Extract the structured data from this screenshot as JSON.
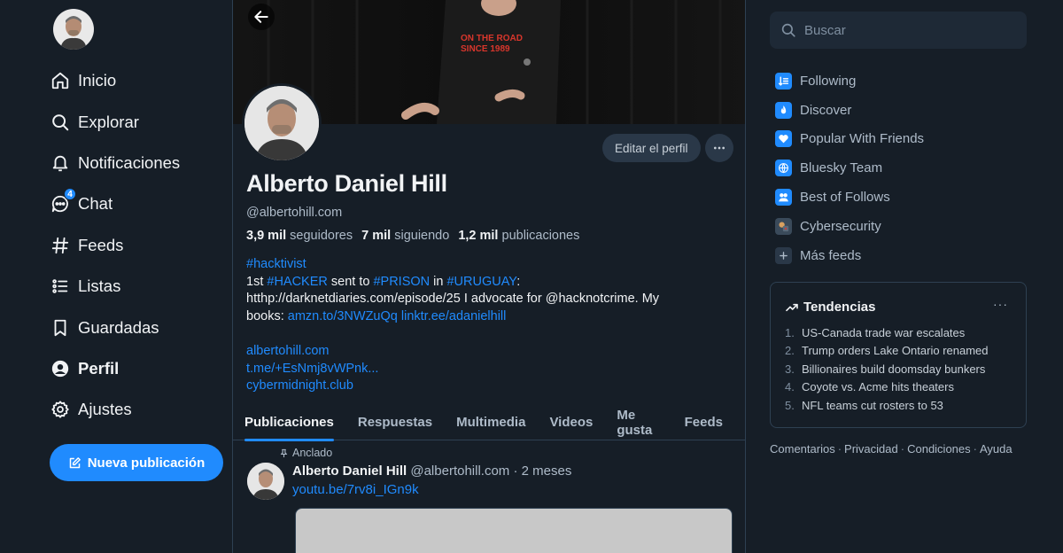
{
  "nav": {
    "items": [
      {
        "id": "home",
        "label": "Inicio",
        "icon": "home-icon"
      },
      {
        "id": "explore",
        "label": "Explorar",
        "icon": "search-icon"
      },
      {
        "id": "notifications",
        "label": "Notificaciones",
        "icon": "bell-icon"
      },
      {
        "id": "chat",
        "label": "Chat",
        "icon": "chat-bubble-icon",
        "badge": "4"
      },
      {
        "id": "feeds",
        "label": "Feeds",
        "icon": "hash-icon"
      },
      {
        "id": "lists",
        "label": "Listas",
        "icon": "list-icon"
      },
      {
        "id": "saved",
        "label": "Guardadas",
        "icon": "bookmark-icon"
      },
      {
        "id": "profile",
        "label": "Perfil",
        "icon": "user-circle-icon",
        "active": true
      },
      {
        "id": "settings",
        "label": "Ajustes",
        "icon": "gear-icon"
      }
    ],
    "new_post_label": "Nueva publicación"
  },
  "profile": {
    "display_name": "Alberto Daniel Hill",
    "handle": "@albertohill.com",
    "edit_label": "Editar el perfil",
    "stats": {
      "followers_count": "3,9 mil",
      "followers_label": "seguidores",
      "following_count": "7 mil",
      "following_label": "siguiendo",
      "posts_count": "1,2 mil",
      "posts_label": "publicaciones"
    },
    "bio": {
      "line1_tag": "#hacktivist",
      "line2_prefix": "1st ",
      "line2_tag1": "#HACKER",
      "line2_mid1": " sent to ",
      "line2_tag2": "#PRISON",
      "line2_mid2": " in ",
      "line2_tag3": "#URUGUAY",
      "line2_suffix": ":",
      "line3": "htthp://darknetdiaries.com/episode/25 I advocate for @hacknotcrime. My",
      "line4_prefix": "books: ",
      "line4_link1": "amzn.to/3NWZuQq",
      "line4_link2": "linktr.ee/adanielhill",
      "link_a": "albertohill.com",
      "link_b": "t.me/+EsNmj8vWPnk...",
      "link_c": "cybermidnight.club"
    },
    "banner_shirt_text": {
      "line1": "ON THE ROAD",
      "line2": "SINCE 1989"
    }
  },
  "tabs": [
    "Publicaciones",
    "Respuestas",
    "Multimedia",
    "Videos",
    "Me gusta",
    "Feeds"
  ],
  "post": {
    "pinned_label": "Anclado",
    "author": "Alberto Daniel Hill",
    "meta": "@albertohill.com · 2 meses",
    "link": "youtu.be/7rv8i_IGn9k"
  },
  "search": {
    "placeholder": "Buscar"
  },
  "feeds": [
    {
      "label": "Following",
      "icon": "following-feed-icon",
      "color": "#208bfe"
    },
    {
      "label": "Discover",
      "icon": "discover-feed-icon",
      "color": "#208bfe"
    },
    {
      "label": "Popular With Friends",
      "icon": "heart-feed-icon",
      "color": "#208bfe"
    },
    {
      "label": "Bluesky Team",
      "icon": "bluesky-team-feed-icon",
      "color": "#208bfe"
    },
    {
      "label": "Best of Follows",
      "icon": "best-of-follows-feed-icon",
      "color": "#208bfe"
    },
    {
      "label": "Cybersecurity",
      "icon": "cybersecurity-feed-icon",
      "color": "#3a4a5a"
    },
    {
      "label": "Más feeds",
      "icon": "plus-icon",
      "color": "#2a3848"
    }
  ],
  "trending": {
    "title": "Tendencias",
    "items": [
      {
        "num": "1.",
        "text": "US-Canada trade war escalates"
      },
      {
        "num": "2.",
        "text": "Trump orders Lake Ontario renamed"
      },
      {
        "num": "3.",
        "text": "Billionaires build doomsday bunkers"
      },
      {
        "num": "4.",
        "text": "Coyote vs. Acme hits theaters"
      },
      {
        "num": "5.",
        "text": "NFL teams cut rosters to 53"
      }
    ]
  },
  "footer": [
    "Comentarios",
    "Privacidad",
    "Condiciones",
    "Ayuda"
  ],
  "colors": {
    "accent": "#208bfe",
    "background": "#161e27",
    "border": "#2e4052",
    "muted": "#aebbc9"
  }
}
